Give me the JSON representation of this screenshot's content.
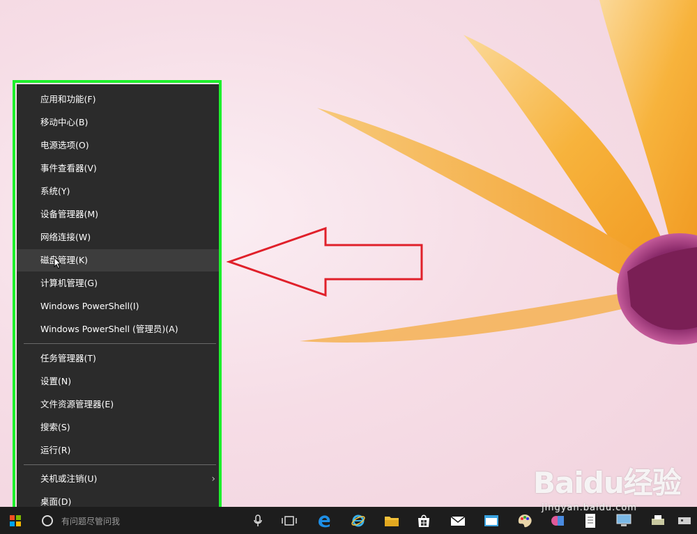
{
  "menu": {
    "items": [
      {
        "label": "应用和功能(F)"
      },
      {
        "label": "移动中心(B)"
      },
      {
        "label": "电源选项(O)"
      },
      {
        "label": "事件查看器(V)"
      },
      {
        "label": "系统(Y)"
      },
      {
        "label": "设备管理器(M)"
      },
      {
        "label": "网络连接(W)"
      },
      {
        "label": "磁盘管理(K)"
      },
      {
        "label": "计算机管理(G)"
      },
      {
        "label": "Windows PowerShell(I)"
      },
      {
        "label": "Windows PowerShell (管理员)(A)"
      }
    ],
    "items2": [
      {
        "label": "任务管理器(T)"
      },
      {
        "label": "设置(N)"
      },
      {
        "label": "文件资源管理器(E)"
      },
      {
        "label": "搜索(S)"
      },
      {
        "label": "运行(R)"
      }
    ],
    "items3": [
      {
        "label": "关机或注销(U)"
      },
      {
        "label": "桌面(D)"
      }
    ],
    "hovered": "磁盘管理(K)"
  },
  "taskbar": {
    "search_placeholder": "有问题尽管问我"
  },
  "watermark": {
    "brand": "Baidu经验",
    "url": "jingyan.baidu.com"
  },
  "colors": {
    "highlight_frame": "#1ef02c",
    "arrow": "#e0202a",
    "menu_bg": "#2b2b2b"
  }
}
